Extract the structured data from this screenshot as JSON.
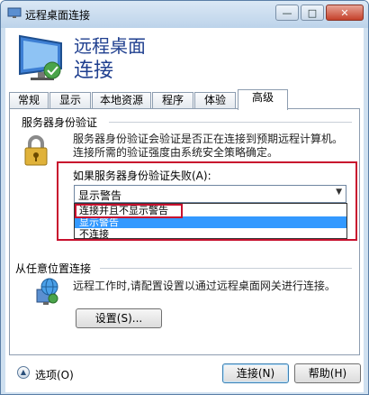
{
  "window": {
    "title": "远程桌面连接",
    "minimize": "—",
    "maximize": "□",
    "close": "✕"
  },
  "header": {
    "line1": "远程桌面",
    "line2": "连接"
  },
  "tabs": [
    {
      "label": "常规"
    },
    {
      "label": "显示"
    },
    {
      "label": "本地资源"
    },
    {
      "label": "程序"
    },
    {
      "label": "体验"
    },
    {
      "label": "高级"
    }
  ],
  "active_tab": "高级",
  "server_auth": {
    "heading": "服务器身份验证",
    "desc1": "服务器身份验证会验证是否正在连接到预期远程计算机。",
    "desc2": "连接所需的验证强度由系统安全策略确定。",
    "dropdown_label": "如果服务器身份验证失败(A):",
    "selected": "显示警告",
    "options": [
      "连接并且不显示警告",
      "显示警告",
      "不连接"
    ],
    "highlighted_index": 1
  },
  "anywhere": {
    "heading": "从任意位置连接",
    "desc": "远程工作时,请配置设置以通过远程桌面网关进行连接。",
    "settings_button": "设置(S)..."
  },
  "footer": {
    "options_label": "选项(O)",
    "connect_button": "连接(N)",
    "help_button": "帮助(H)"
  },
  "colors": {
    "accent_title": "#1f3f8f",
    "highlight": "#c8102e",
    "selection": "#3399ff"
  }
}
